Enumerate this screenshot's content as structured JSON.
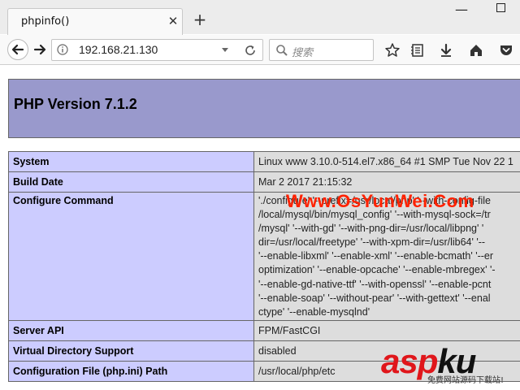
{
  "browser": {
    "tab_title": "phpinfo()",
    "url": "192.168.21.130",
    "search_placeholder": "搜索"
  },
  "page": {
    "header_title": "PHP Version 7.1.2",
    "rows": [
      {
        "label": "System",
        "value_lines": [
          "Linux www 3.10.0-514.el7.x86_64 #1 SMP Tue Nov 22 1"
        ]
      },
      {
        "label": "Build Date",
        "value_lines": [
          "Mar 2 2017 21:15:32"
        ]
      },
      {
        "label": "Configure Command",
        "value_lines": [
          "'./configure' '--prefix=/usr/local/php' '--with-config-file",
          "/local/mysql/bin/mysql_config' '--with-mysql-sock=/tr",
          "/mysql' '--with-gd' '--with-png-dir=/usr/local/libpng' '",
          "dir=/usr/local/freetype' '--with-xpm-dir=/usr/lib64' '--",
          "'--enable-libxml' '--enable-xml' '--enable-bcmath' '--er",
          "optimization' '--enable-opcache' '--enable-mbregex' '-",
          "'--enable-gd-native-ttf' '--with-openssl' '--enable-pcnt",
          "'--enable-soap' '--without-pear' '--with-gettext' '--enal",
          "ctype' '--enable-mysqlnd'"
        ]
      },
      {
        "label": "Server API",
        "value_lines": [
          "FPM/FastCGI"
        ]
      },
      {
        "label": "Virtual Directory Support",
        "value_lines": [
          "disabled"
        ]
      },
      {
        "label": "Configuration File (php.ini) Path",
        "value_lines": [
          "/usr/local/php/etc"
        ]
      }
    ]
  },
  "watermarks": {
    "site": "Www.OsYunWei.Com",
    "asp": "asp",
    "ku": "ku",
    "slogan": "免费网站源码下载站!"
  },
  "colors": {
    "php_header": "#9999cc",
    "label_cell": "#ccccff",
    "value_cell": "#dddddd",
    "watermark_red": "#ff2200"
  }
}
